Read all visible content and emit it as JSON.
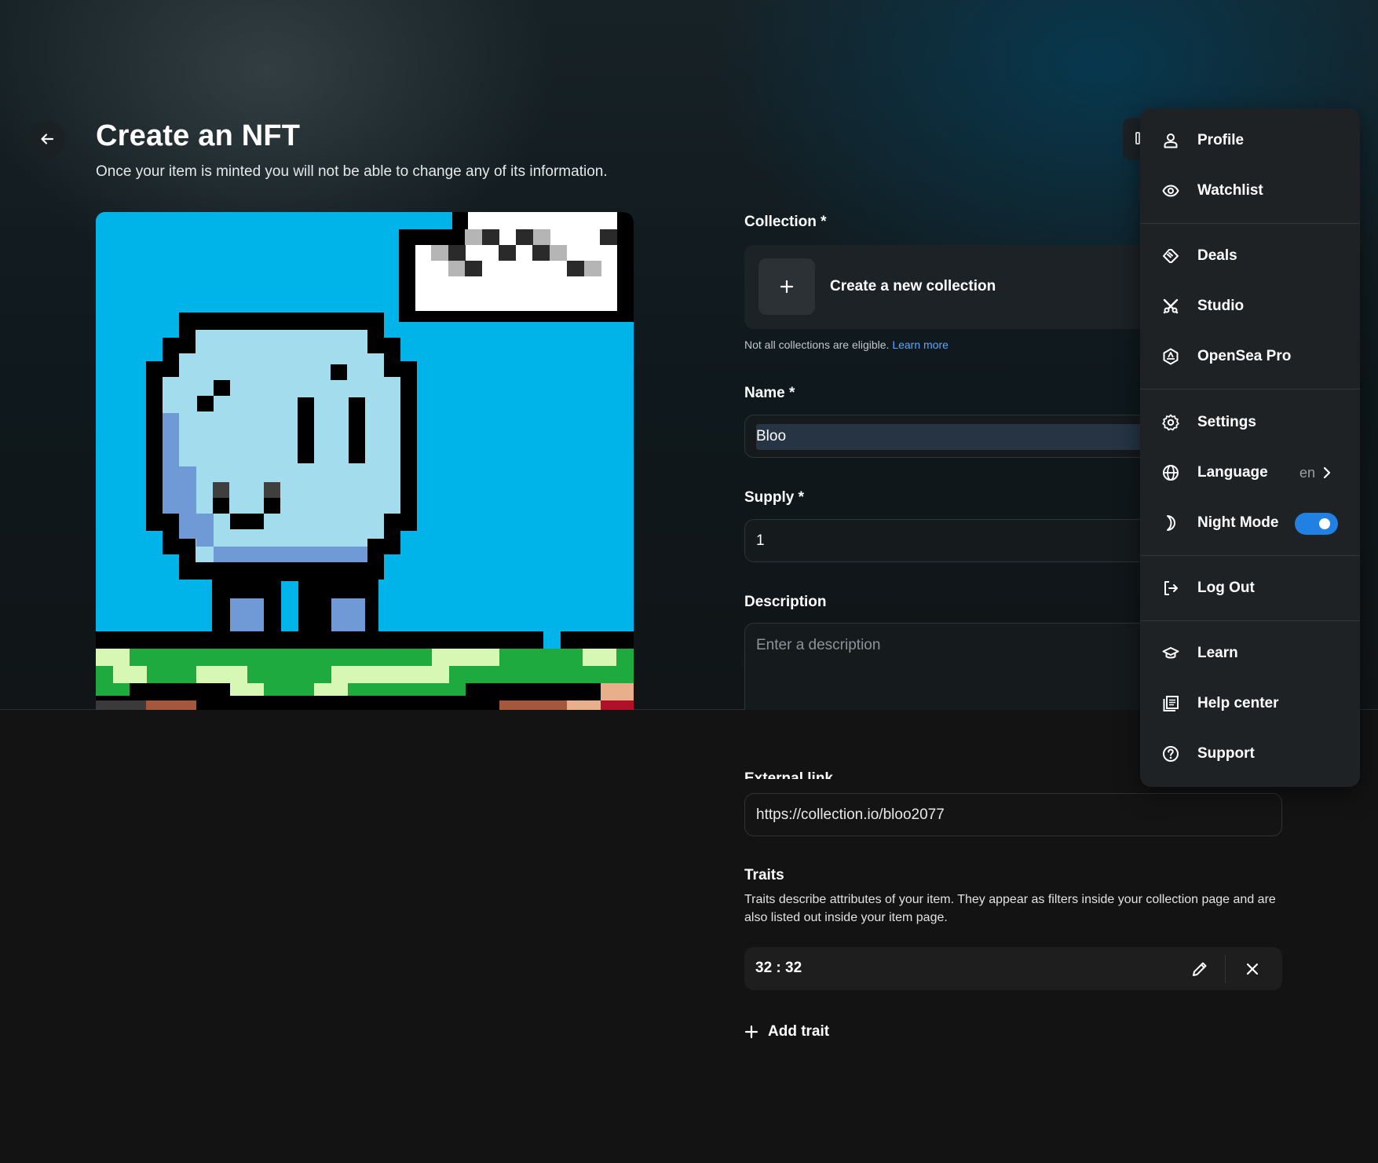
{
  "header": {
    "title": "Create an NFT",
    "subtitle": "Once your item is minted you will not be able to change any of its information."
  },
  "icons": {
    "back": "arrow-left-icon",
    "collection_add": "plus-icon",
    "trait_edit": "pencil-icon",
    "trait_remove": "close-icon",
    "add_trait": "plus-icon"
  },
  "form": {
    "collection": {
      "label": "Collection *",
      "create_label": "Create a new collection",
      "hint": "Not all collections are eligible.",
      "hint_link": "Learn more"
    },
    "name": {
      "label": "Name *",
      "value": "Bloo"
    },
    "supply": {
      "label": "Supply *",
      "value": "1"
    },
    "description": {
      "label": "Description",
      "placeholder": "Enter a description"
    },
    "external_link": {
      "label": "External link",
      "value": "https://collection.io/bloo2077"
    },
    "traits": {
      "label": "Traits",
      "description": "Traits describe attributes of your item. They appear as filters inside your collection page and are also listed out inside your item page.",
      "items": [
        {
          "value": "32 : 32"
        }
      ],
      "add_label": "Add trait"
    }
  },
  "menu": {
    "items": [
      {
        "label": "Profile",
        "icon": "user-icon"
      },
      {
        "label": "Watchlist",
        "icon": "eye-icon"
      },
      {
        "label": "Deals",
        "icon": "handshake-icon"
      },
      {
        "label": "Studio",
        "icon": "studio-tools-icon"
      },
      {
        "label": "OpenSea Pro",
        "icon": "opensea-pro-icon"
      },
      {
        "label": "Settings",
        "icon": "gear-icon"
      },
      {
        "label": "Language",
        "icon": "globe-icon",
        "value": "en"
      },
      {
        "label": "Night Mode",
        "icon": "moon-icon",
        "toggle_on": true
      },
      {
        "label": "Log Out",
        "icon": "logout-icon"
      },
      {
        "label": "Learn",
        "icon": "graduation-cap-icon"
      },
      {
        "label": "Help center",
        "icon": "book-icon"
      },
      {
        "label": "Support",
        "icon": "question-circle-icon"
      }
    ]
  },
  "colors": {
    "accent": "#2081e2",
    "link": "#5aa8ff",
    "image_sky": "#00b4ea",
    "character_body": "#a3dcec",
    "character_shade": "#6f9ad6"
  }
}
